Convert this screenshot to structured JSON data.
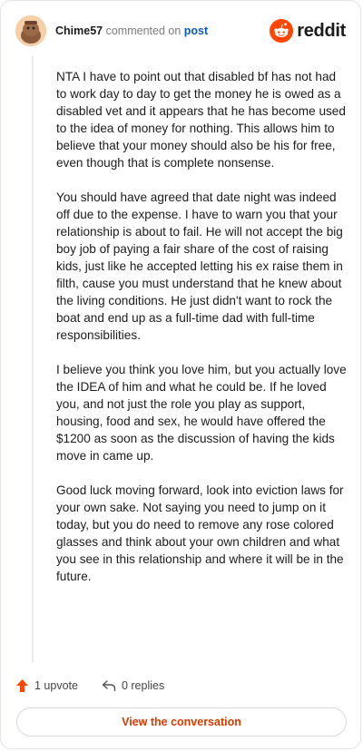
{
  "comment": {
    "author": "Chime57",
    "verb": "commented on",
    "target_link": "post",
    "brand": "reddit",
    "paragraphs": [
      "NTA I have to point out that disabled bf has not had to work day to day to get the money he is owed as a disabled vet and it appears that he has become used to the idea of money for nothing. This allows him to believe that your money should also be his for free, even though that is complete nonsense.",
      "You should have agreed that date night was indeed off due to the expense. I have to warn you that your relationship is about to fail. He will not accept the big boy job of paying a fair share of the cost of raising kids, just like he accepted letting his ex raise them in filth, cause you must understand that he knew about the living conditions. He just didn't want to rock the boat and end up as a full-time dad with full-time responsibilities.",
      "I believe you think you love him, but you actually love the IDEA of him and what he could be. If he loved you, and not just the role you play as support, housing, food and sex, he would have offered the $1200 as soon as the discussion of having the kids move in came up.",
      "Good luck moving forward, look into eviction laws for your own sake. Not saying you need to jump on it today, but you do need to remove any rose colored glasses and think about your own children and what you see in this relationship and where it will be in the future."
    ]
  },
  "actions": {
    "upvote_label": "1 upvote",
    "replies_label": "0 replies",
    "view_conversation_label": "View the conversation"
  },
  "icons": {
    "upvote": "upvote-arrow-icon",
    "reply": "reply-arrow-icon",
    "brand": "reddit-logo-icon"
  },
  "colors": {
    "accent": "#ff4500",
    "link": "#0f5bb5",
    "cta_text": "#d93a00"
  }
}
